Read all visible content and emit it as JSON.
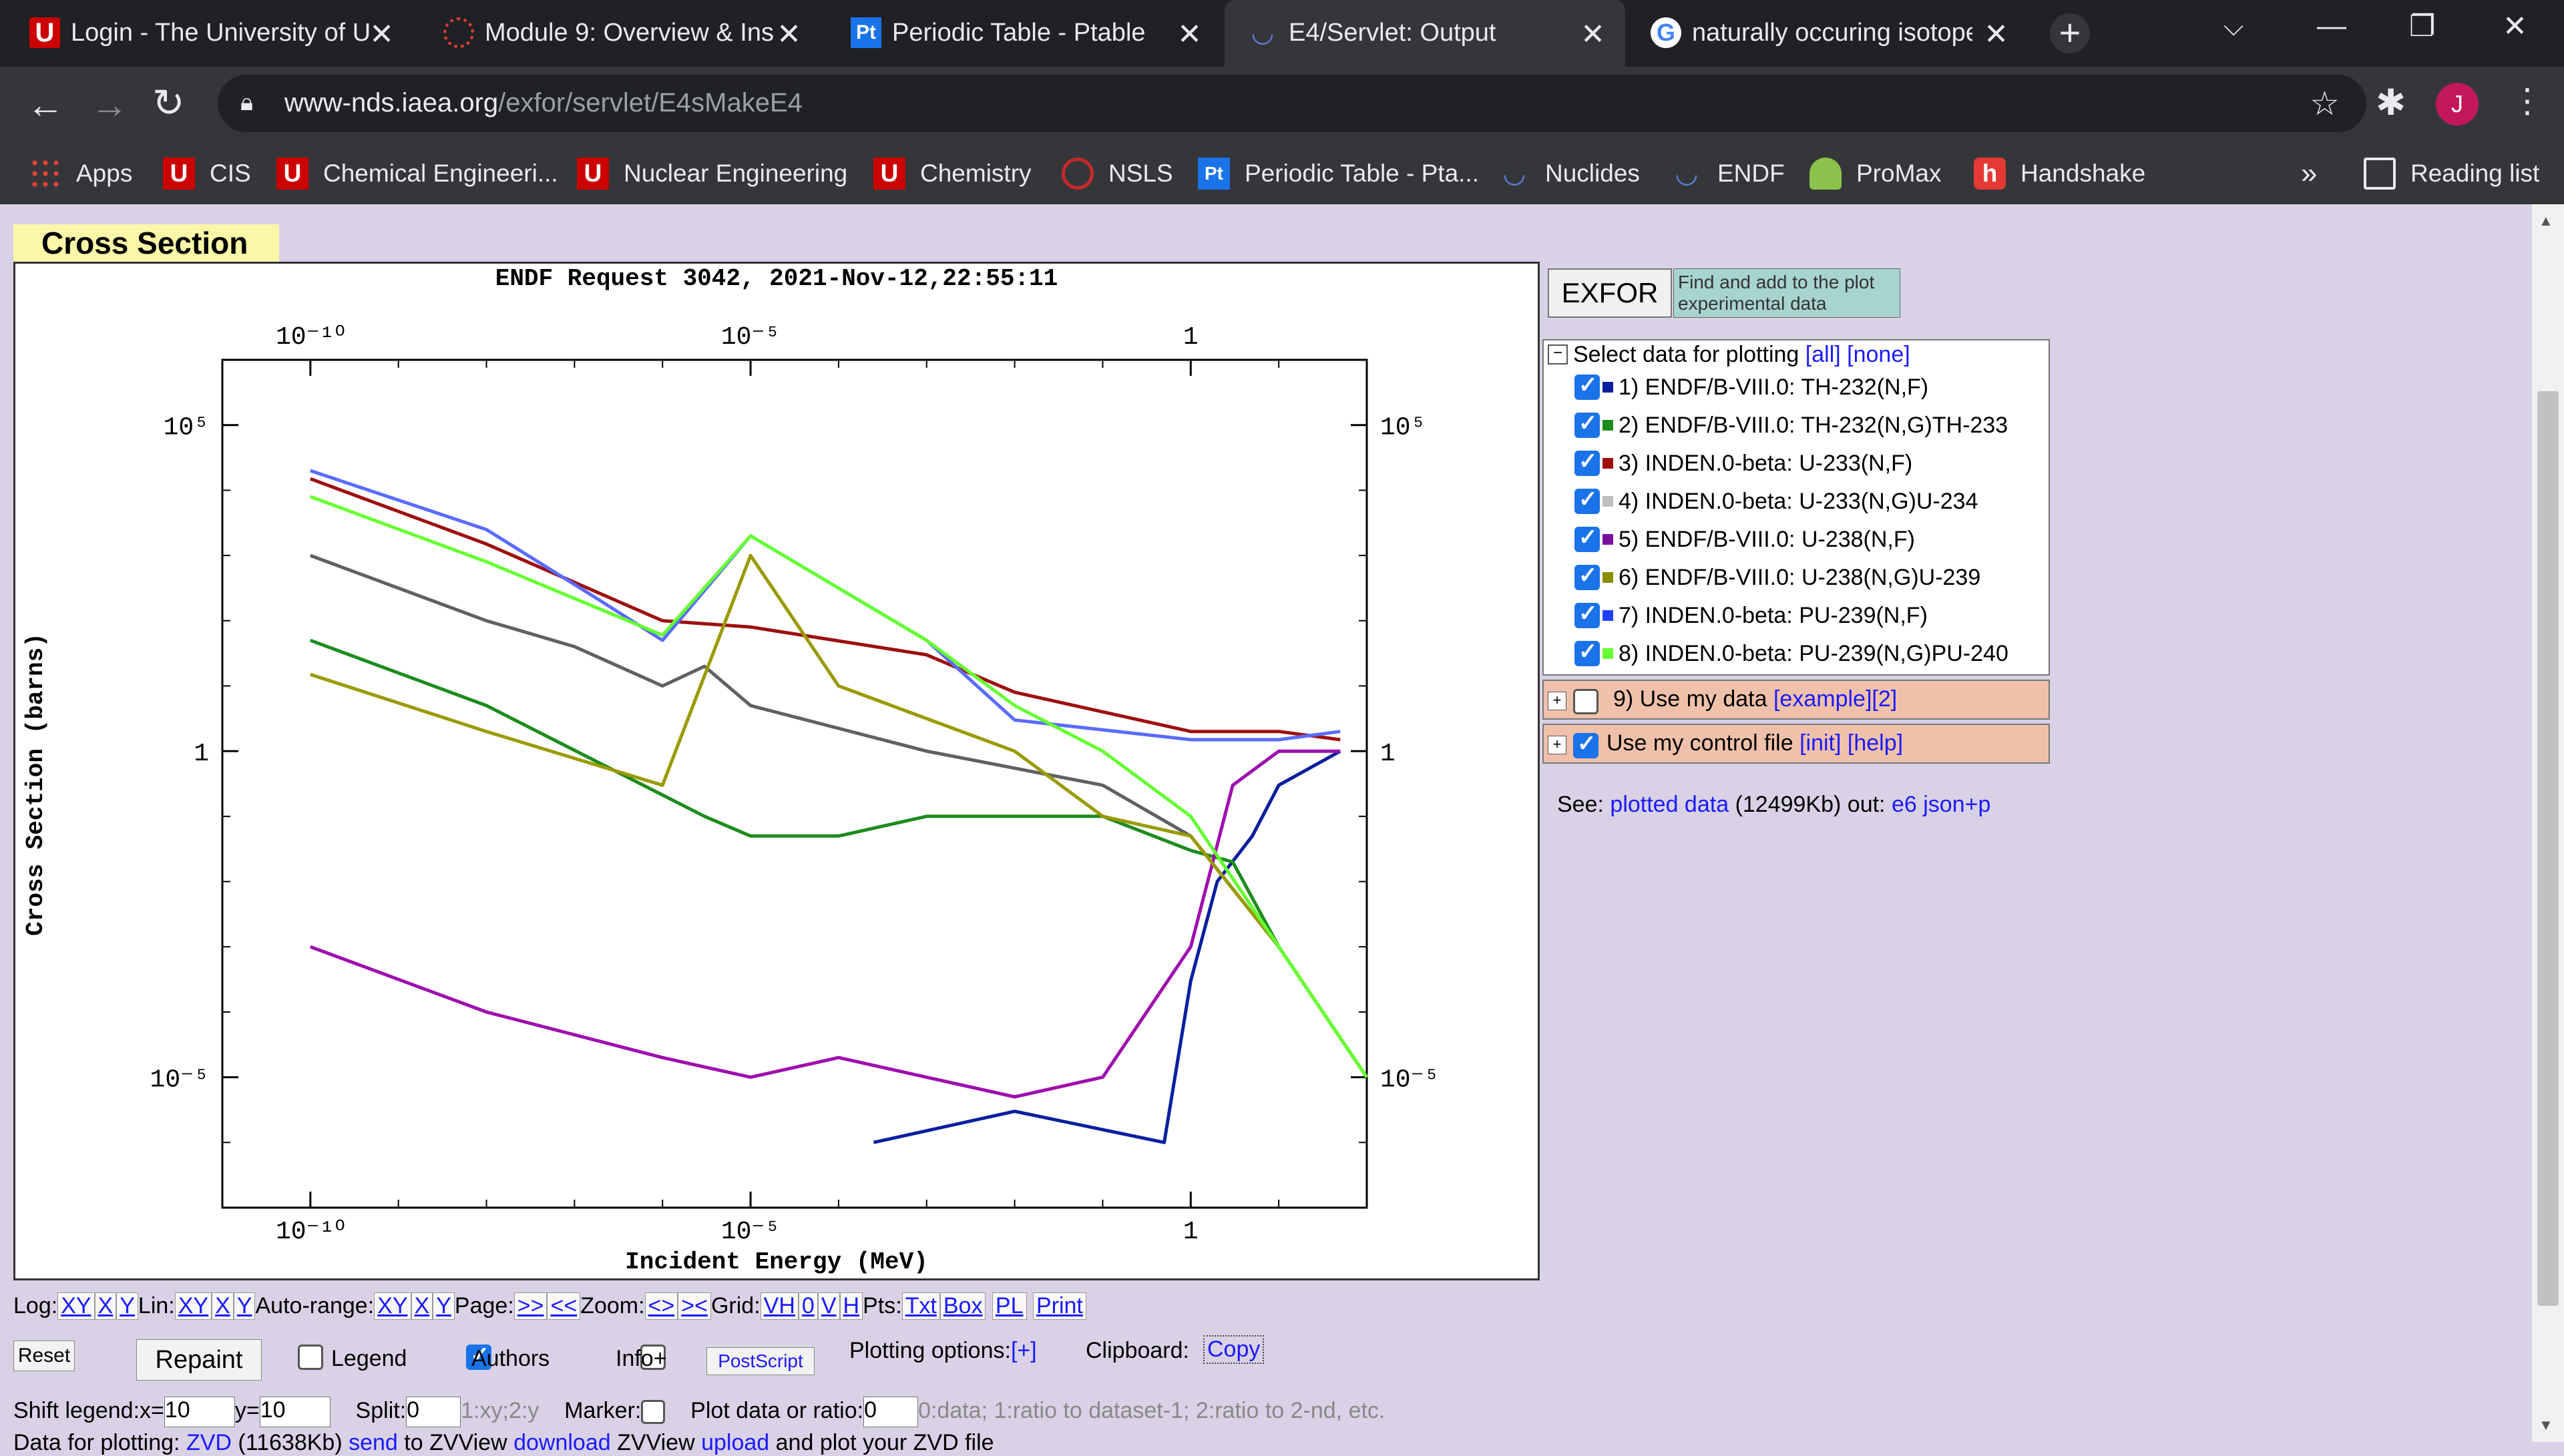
{
  "browser": {
    "tabs": [
      {
        "title": "Login - The University of U",
        "favicon": "university-u-icon",
        "active": false
      },
      {
        "title": "Module 9: Overview & Ins",
        "favicon": "canvas-icon",
        "active": false
      },
      {
        "title": "Periodic Table - Ptable",
        "favicon": "ptable-icon",
        "active": false
      },
      {
        "title": "E4/Servlet: Output",
        "favicon": "iaea-icon",
        "active": true
      },
      {
        "title": "naturally occuring isotope",
        "favicon": "google-icon",
        "active": false
      }
    ],
    "url_host": "www-nds.iaea.org",
    "url_path": "/exfor/servlet/E4sMakeE4",
    "profile_initial": "J",
    "bookmarks": [
      {
        "label": "Apps",
        "icon": "apps-grid-icon"
      },
      {
        "label": "CIS",
        "icon": "university-u-icon"
      },
      {
        "label": "Chemical Engineeri...",
        "icon": "university-u-icon"
      },
      {
        "label": "Nuclear Engineering",
        "icon": "university-u-icon"
      },
      {
        "label": "Chemistry",
        "icon": "university-u-icon"
      },
      {
        "label": "NSLS",
        "icon": "nsls-icon"
      },
      {
        "label": "Periodic Table - Pta...",
        "icon": "ptable-icon"
      },
      {
        "label": "Nuclides",
        "icon": "iaea-icon"
      },
      {
        "label": "ENDF",
        "icon": "iaea-icon"
      },
      {
        "label": "ProMax",
        "icon": "promax-icon"
      },
      {
        "label": "Handshake",
        "icon": "handshake-icon"
      }
    ],
    "more_bookmarks": "»",
    "reading_list": "Reading list"
  },
  "page": {
    "section_title": "Cross Section",
    "exfor_button": "EXFOR",
    "exfor_desc": "Find and add to the plot experimental data",
    "select_title": "Select data for plotting",
    "select_all": "[all]",
    "select_none": "[none]",
    "datasets": [
      {
        "label": "1) ENDF/B-VIII.0: TH-232(N,F)",
        "color": "#0a1f9e",
        "checked": true
      },
      {
        "label": "2) ENDF/B-VIII.0: TH-232(N,G)TH-233",
        "color": "#1c8c1c",
        "checked": true
      },
      {
        "label": "3) INDEN.0-beta: U-233(N,F)",
        "color": "#9e0f0f",
        "checked": true
      },
      {
        "label": "4) INDEN.0-beta: U-233(N,G)U-234",
        "color": "#bfbfbf",
        "checked": true
      },
      {
        "label": "5) ENDF/B-VIII.0: U-238(N,F)",
        "color": "#7a0f9e",
        "checked": true
      },
      {
        "label": "6) ENDF/B-VIII.0: U-238(N,G)U-239",
        "color": "#8c8c00",
        "checked": true
      },
      {
        "label": "7) INDEN.0-beta: PU-239(N,F)",
        "color": "#1f3fff",
        "checked": true
      },
      {
        "label": "8) INDEN.0-beta: PU-239(N,G)PU-240",
        "color": "#66ff33",
        "checked": true
      }
    ],
    "use_my_data": "9) Use my data",
    "use_my_data_example": "[example]",
    "use_my_data_two": "[2]",
    "use_control_file": "Use my control file",
    "control_init": "[init]",
    "control_help": "[help]",
    "see_label": "See:",
    "plotted_data": "plotted data",
    "plotted_size": "(12499Kb)",
    "out_label": "out:",
    "e6_link": "e6",
    "json_link": "json+p",
    "controls": {
      "log": "Log:",
      "lin": "Lin:",
      "autorange": "Auto-range:",
      "page": "Page:",
      "zoom": "Zoom:",
      "grid": "Grid:",
      "pts": "Pts:",
      "xy": "XY",
      "x": "X",
      "y": "Y",
      "next": ">>",
      "prev": "<<",
      "zin": "<>",
      "zout": "><",
      "vh": "VH",
      "zero": "0",
      "v": "V",
      "h": "H",
      "txt": "Txt",
      "box": "Box",
      "pl": "PL",
      "print": "Print",
      "reset": "Reset",
      "repaint": "Repaint",
      "legend": "Legend",
      "authors": "Authors",
      "info": "Info+",
      "postscript": "PostScript",
      "plotting_options": "Plotting options:",
      "plus": "[+]",
      "clipboard": "Clipboard:",
      "copy": "Copy",
      "shift_legend": "Shift legend:x=",
      "shift_x": "10",
      "shift_y_label": "y=",
      "shift_y": "10",
      "split": "Split:",
      "split_val": "0",
      "split_hint": "1:xy;2:y",
      "marker": "Marker:",
      "ratio": "Plot data or ratio:",
      "ratio_val": "0",
      "ratio_hint": "0:data; 1:ratio to dataset-1; 2:ratio to 2-nd, etc.",
      "data_for_plotting": "Data for plotting:",
      "zvd": "ZVD",
      "zvd_size": "(11638Kb)",
      "send": "send",
      "to_zvview": "to ZVView",
      "download": "download",
      "zvview_text": "ZVView",
      "upload": "upload",
      "and_plot": "and plot your ZVD file"
    }
  },
  "chart_data": {
    "type": "line",
    "title": "ENDF Request 3042, 2021-Nov-12,22:55:11",
    "xlabel": "Incident Energy (MeV)",
    "ylabel": "Cross Section (barns)",
    "xscale": "log",
    "yscale": "log",
    "xlim": [
      1e-11,
      100
    ],
    "ylim": [
      1e-07,
      1000000.0
    ],
    "x_ticks": [
      "10⁻¹⁰",
      "10⁻⁵",
      "1"
    ],
    "y_ticks": [
      "10⁵",
      "1",
      "10⁻⁵"
    ],
    "grid": false,
    "legend": "none",
    "series": [
      {
        "name": "ENDF/B-VIII.0: TH-232(N,F)",
        "color": "#0a1f9e",
        "points": [
          [
            0.00025,
            1e-06
          ],
          [
            0.01,
            3e-06
          ],
          [
            0.5,
            1e-06
          ],
          [
            1,
            0.0003
          ],
          [
            2,
            0.01
          ],
          [
            5,
            0.05
          ],
          [
            10,
            0.3
          ],
          [
            50,
            1
          ]
        ]
      },
      {
        "name": "ENDF/B-VIII.0: TH-232(N,G)TH-233",
        "color": "#1c8c1c",
        "points": [
          [
            1e-10,
            50
          ],
          [
            1e-08,
            5
          ],
          [
            3e-06,
            0.1
          ],
          [
            1e-05,
            0.05
          ],
          [
            0.0001,
            0.05
          ],
          [
            0.001,
            0.1
          ],
          [
            0.1,
            0.1
          ],
          [
            1,
            0.03
          ],
          [
            3,
            0.02
          ],
          [
            10,
            0.001
          ],
          [
            100,
            1e-05
          ]
        ]
      },
      {
        "name": "INDEN.0-beta: U-233(N,F)",
        "color": "#9e0f0f",
        "points": [
          [
            1e-10,
            15000
          ],
          [
            1e-08,
            1500
          ],
          [
            1e-06,
            100
          ],
          [
            1e-05,
            80
          ],
          [
            0.001,
            30
          ],
          [
            0.01,
            8
          ],
          [
            1,
            2
          ],
          [
            10,
            2
          ],
          [
            50,
            1.5
          ]
        ]
      },
      {
        "name": "INDEN.0-beta: U-233(N,G)U-234",
        "color": "#606060",
        "points": [
          [
            1e-10,
            1000
          ],
          [
            1e-08,
            100
          ],
          [
            1e-07,
            40
          ],
          [
            1e-06,
            10
          ],
          [
            3e-06,
            20
          ],
          [
            1e-05,
            5
          ],
          [
            0.001,
            1
          ],
          [
            0.1,
            0.3
          ],
          [
            1,
            0.05
          ],
          [
            10,
            0.001
          ],
          [
            100,
            1e-05
          ]
        ]
      },
      {
        "name": "ENDF/B-VIII.0: U-238(N,F)",
        "color": "#9e0fae",
        "points": [
          [
            1e-10,
            0.001
          ],
          [
            1e-08,
            0.0001
          ],
          [
            1e-06,
            2e-05
          ],
          [
            1e-05,
            1e-05
          ],
          [
            0.0001,
            2e-05
          ],
          [
            0.01,
            5e-06
          ],
          [
            0.1,
            1e-05
          ],
          [
            1,
            0.001
          ],
          [
            3,
            0.3
          ],
          [
            10,
            1
          ],
          [
            50,
            1
          ]
        ]
      },
      {
        "name": "ENDF/B-VIII.0: U-238(N,G)U-239",
        "color": "#9a9a00",
        "points": [
          [
            1e-10,
            15
          ],
          [
            1e-08,
            2
          ],
          [
            1e-06,
            0.3
          ],
          [
            1e-05,
            1000
          ],
          [
            0.0001,
            10
          ],
          [
            0.01,
            1
          ],
          [
            0.1,
            0.1
          ],
          [
            1,
            0.05
          ],
          [
            10,
            0.001
          ],
          [
            100,
            1e-05
          ]
        ]
      },
      {
        "name": "INDEN.0-beta: PU-239(N,F)",
        "color": "#5a6cff",
        "points": [
          [
            1e-10,
            20000
          ],
          [
            1e-08,
            2500
          ],
          [
            2e-07,
            200
          ],
          [
            1e-06,
            50
          ],
          [
            1e-05,
            2000
          ],
          [
            0.001,
            50
          ],
          [
            0.01,
            3
          ],
          [
            1,
            1.5
          ],
          [
            10,
            1.5
          ],
          [
            50,
            2
          ]
        ]
      },
      {
        "name": "INDEN.0-beta: PU-239(N,G)PU-240",
        "color": "#66ff33",
        "points": [
          [
            1e-10,
            8000
          ],
          [
            1e-08,
            800
          ],
          [
            1e-06,
            60
          ],
          [
            1e-05,
            2000
          ],
          [
            0.001,
            50
          ],
          [
            0.01,
            5
          ],
          [
            0.1,
            1
          ],
          [
            1,
            0.1
          ],
          [
            10,
            0.001
          ],
          [
            100,
            1e-05
          ]
        ]
      }
    ]
  }
}
